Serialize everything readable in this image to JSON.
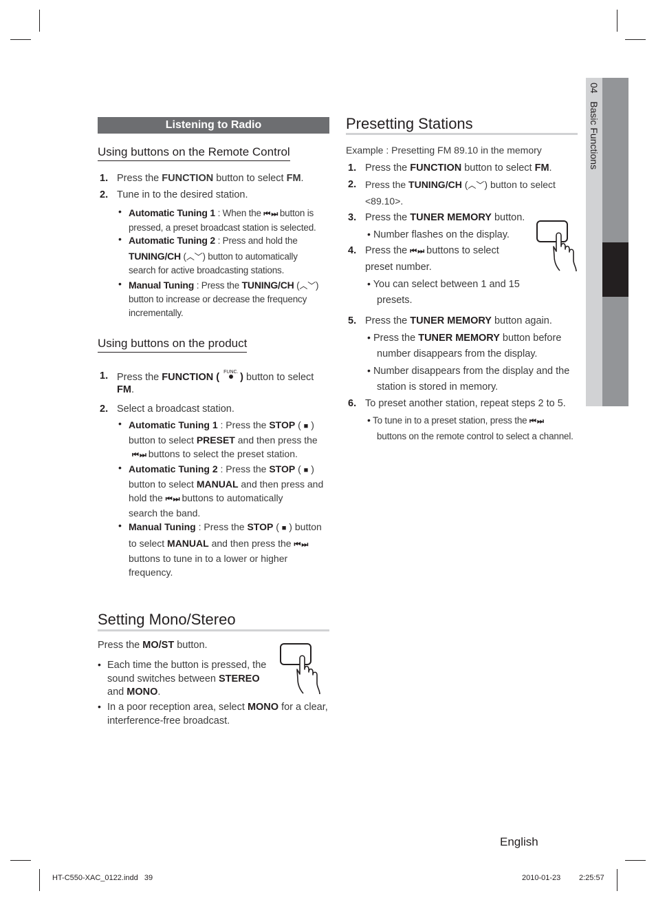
{
  "side_tab": {
    "chapter_number": "04",
    "chapter_title": "Basic Functions"
  },
  "left_column": {
    "section_title": "Listening to Radio",
    "remote": {
      "heading": "Using buttons on the Remote Control",
      "steps": [
        {
          "num": "1.",
          "pre": "Press the ",
          "bold1": "FUNCTION",
          "mid": " button to select ",
          "bold2": "FM",
          "post": "."
        },
        {
          "num": "2.",
          "text": "Tune in to the desired station."
        }
      ],
      "bullets": [
        {
          "label": "Automatic Tuning 1",
          "line1_pre": " : When the ",
          "line1_post": " button is",
          "line2": "pressed, a preset broadcast station is selected."
        },
        {
          "label": "Automatic Tuning 2",
          "line1": " : Press and hold the",
          "line2_bold": "TUNING/CH",
          "line2_post": " button to automatically",
          "line3": "search for active broadcasting stations."
        },
        {
          "label": "Manual Tuning",
          "line1_pre": " : Press the ",
          "line1_bold": "TUNING/CH",
          "line2": "button to increase or decrease the frequency",
          "line3": "incrementally."
        }
      ]
    },
    "product": {
      "heading": "Using buttons on the product",
      "step1": {
        "num": "1.",
        "pre": "Press the ",
        "bold": "FUNCTION",
        "func_label": "FUNC.",
        "post": " button to select",
        "line2_bold": "FM",
        "line2_post": "."
      },
      "step2": {
        "num": "2.",
        "text": "Select a broadcast station."
      },
      "bullets": [
        {
          "label": "Automatic Tuning 1",
          "l1_pre": " : Press the ",
          "l1_bold": "STOP",
          "l2_pre": "button to select ",
          "l2_bold": "PRESET",
          "l2_post": " and then press the",
          "l3_post": " buttons to select the preset station."
        },
        {
          "label": "Automatic Tuning 2",
          "l1_pre": " : Press the ",
          "l1_bold": "STOP",
          "l2_pre": "button to select ",
          "l2_bold": "MANUAL",
          "l2_post": " and then press and",
          "l3_pre": "hold the ",
          "l3_post": " buttons to automatically",
          "l4": "search the band."
        },
        {
          "label": "Manual Tuning",
          "l1_pre": " : Press the ",
          "l1_bold": "STOP",
          "l1_post": " button",
          "l2_pre": "to select ",
          "l2_bold": "MANUAL",
          "l2_post": " and then press the",
          "l3": "buttons to tune in to a lower or higher",
          "l4": "frequency."
        }
      ]
    },
    "mono": {
      "heading": "Setting Mono/Stereo",
      "intro_pre": "Press the ",
      "intro_bold": "MO/ST",
      "intro_post": " button.",
      "b1_l1": "Each time the button is pressed, the",
      "b1_l2_pre": "sound switches between ",
      "b1_l2_bold": "STEREO",
      "b1_l3_pre": "and ",
      "b1_l3_bold": "MONO",
      "b1_l3_post": ".",
      "b2_l1_pre": "In a poor reception area, select ",
      "b2_l1_bold": "MONO",
      "b2_l1_post": " for a clear,",
      "b2_l2": "interference-free broadcast."
    }
  },
  "right_column": {
    "heading": "Presetting Stations",
    "example": "Example : Presetting FM 89.10 in the memory",
    "s1": {
      "num": "1.",
      "pre": "Press the ",
      "bold1": "FUNCTION",
      "mid": " button to select ",
      "bold2": "FM",
      "post": "."
    },
    "s2": {
      "num": "2.",
      "pre": "Press the ",
      "bold": "TUNING/CH",
      "post": " button to select",
      "line2": "<89.10>."
    },
    "s3": {
      "num": "3.",
      "pre": "Press the ",
      "bold": "TUNER MEMORY",
      "post": " button.",
      "bullet": "Number flashes on the display."
    },
    "s4": {
      "num": "4.",
      "pre": "Press the ",
      "post": " buttons to select",
      "line2": "preset number.",
      "bullet_l1": "You can select between 1 and 15",
      "bullet_l2": "presets."
    },
    "s5": {
      "num": "5.",
      "pre": "Press the ",
      "bold": "TUNER MEMORY",
      "post": " button again.",
      "b1_pre": "Press the ",
      "b1_bold": "TUNER MEMORY",
      "b1_post": " button before",
      "b1_l2": "number disappears from the display.",
      "b2_l1": "Number disappears from the display and the",
      "b2_l2": "station is stored in memory."
    },
    "s6": {
      "num": "6.",
      "text": "To preset another station, repeat steps 2 to 5.",
      "b_pre": "To tune in to a preset station, press the ",
      "b_l2": "buttons on the remote control to select a channel."
    }
  },
  "glyphs": {
    "skip": "⏮ ⏭",
    "updown": "︿﹀",
    "stop": "■",
    "bullet": "•"
  },
  "footer": {
    "language": "English",
    "file_info": "HT-C550-XAC_0122.indd   39",
    "date": "2010-01-23",
    "time": "2:25:57"
  }
}
